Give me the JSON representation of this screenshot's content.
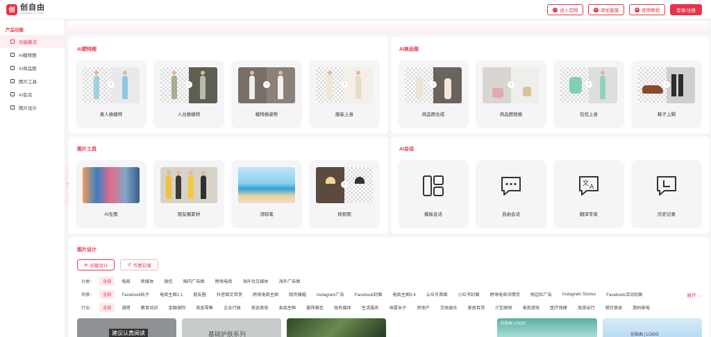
{
  "brand": {
    "name": "创自由",
    "sub": "CHUANG ZI YOU",
    "mark": "创"
  },
  "header": {
    "buttons": [
      {
        "label": "进入官网",
        "icon": "home-icon"
      },
      {
        "label": "添加客服",
        "icon": "service-icon"
      },
      {
        "label": "使用教程",
        "icon": "book-icon"
      },
      {
        "label": "登录/注册"
      }
    ]
  },
  "sidebar": {
    "title": "产品功能",
    "items": [
      {
        "label": "功能概况",
        "active": true
      },
      {
        "label": "AI模特图"
      },
      {
        "label": "AI商品图"
      },
      {
        "label": "图片工具"
      },
      {
        "label": "AI会话"
      },
      {
        "label": "图片设计"
      }
    ],
    "collapse": "‹"
  },
  "sections": {
    "model": {
      "title": "AI模特图",
      "cards": [
        "真人换模特",
        "人台换模特",
        "模特换姿势",
        "服装上身"
      ]
    },
    "product": {
      "title": "AI商品图",
      "cards": [
        "商品图合成",
        "商品图替换",
        "包包上身",
        "鞋子上脚"
      ]
    },
    "tools": {
      "title": "图片工具",
      "cards": [
        "AI生图",
        "朋友圈素材",
        "消除笔",
        "抠抠图"
      ]
    },
    "chat": {
      "title": "AI会话",
      "cards": [
        "模板会话",
        "自由会话",
        "翻译专家",
        "历史记录"
      ]
    }
  },
  "design": {
    "title": "图片设计",
    "tabs": [
      "创建设计",
      "作图记录"
    ],
    "rows": [
      {
        "label": "分类：",
        "chips": [
          "全部",
          "电商",
          "新媒体",
          "微信",
          "国内广告图",
          "跨境电商",
          "海外社交媒体",
          "海外广告图"
        ]
      },
      {
        "label": "场景：",
        "chips": [
          "全部",
          "Facebook帖子",
          "电商主图1:1",
          "朋友圈",
          "抖音图文带货",
          "跨境电商主图",
          "网页横幅",
          "Instagram广告",
          "Facebook封面",
          "电商主图3:4",
          "公众号首图",
          "小红书封面",
          "跨境电商详情页",
          "侧边栏广告",
          "Instagram Stories",
          "Facebook活动封面"
        ]
      },
      {
        "label": "行业：",
        "chips": [
          "全部",
          "通用",
          "教育培训",
          "金融保险",
          "商品零售",
          "企业行政",
          "美容美妆",
          "食品生鲜",
          "服饰箱包",
          "政务媒体",
          "生活服务",
          "母婴亲子",
          "房地产",
          "文体娱乐",
          "家居百货",
          "IT互联网",
          "电竞游戏",
          "医疗保健",
          "旅游出行",
          "餐饮美食",
          "数码家电"
        ]
      }
    ],
    "expand": "展开 ⌵",
    "thumbs": [
      "建议认真阅读",
      "基础护肤系列",
      "",
      "",
      "创自由   LOGO",
      "创自由 | LOGO"
    ]
  }
}
